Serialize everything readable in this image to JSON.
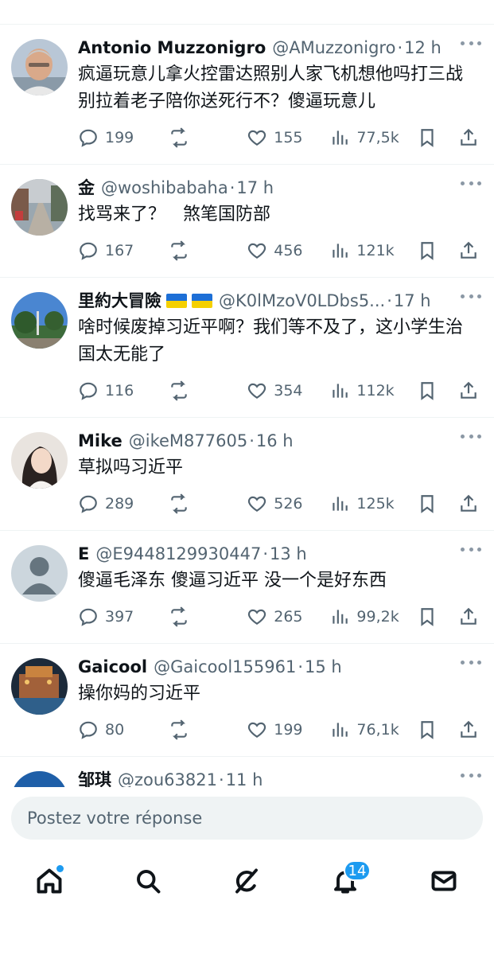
{
  "tweets": [
    {
      "name": "Antonio Muzzonigro",
      "handle": "@AMuzzonigro",
      "time": "12 h",
      "text": "疯逼玩意儿拿火控雷达照别人家飞机想他吗打三战别拉着老子陪你送死行不？傻逼玩意儿",
      "replies": "199",
      "reposts": "",
      "likes": "155",
      "views": "77,5k",
      "flags": 0
    },
    {
      "name": "金",
      "handle": "@woshibabaha",
      "time": "17 h",
      "text": "找骂来了？　煞笔国防部",
      "replies": "167",
      "reposts": "",
      "likes": "456",
      "views": "121k",
      "flags": 0
    },
    {
      "name": "里約大冒險",
      "handle": "@K0lMzoV0LDbs5...",
      "time": "17 h",
      "text": "啥时候废掉习近平啊？我们等不及了，这小学生治国太无能了",
      "replies": "116",
      "reposts": "",
      "likes": "354",
      "views": "112k",
      "flags": 2
    },
    {
      "name": "Mike",
      "handle": "@ikeM877605",
      "time": "16 h",
      "text": "草拟吗习近平",
      "replies": "289",
      "reposts": "",
      "likes": "526",
      "views": "125k",
      "flags": 0
    },
    {
      "name": "E",
      "handle": "@E9448129930447",
      "time": "13 h",
      "text": "傻逼毛泽东 傻逼习近平 没一个是好东西",
      "replies": "397",
      "reposts": "",
      "likes": "265",
      "views": "99,2k",
      "flags": 0
    },
    {
      "name": "Gaicool",
      "handle": "@Gaicool155961",
      "time": "15 h",
      "text": "操你妈的习近平",
      "replies": "80",
      "reposts": "",
      "likes": "199",
      "views": "76,1k",
      "flags": 0
    },
    {
      "name": "邹琪",
      "handle": "@zou63821",
      "time": "11 h",
      "text": "",
      "replies": "",
      "reposts": "",
      "likes": "",
      "views": "",
      "flags": 0
    }
  ],
  "reply_bar": {
    "placeholder": "Postez votre réponse"
  },
  "tabbar": {
    "notifications_badge": "14"
  },
  "colors": {
    "accent": "#1d9bf0",
    "secondary_text": "#536471",
    "divider": "#eff3f4"
  }
}
